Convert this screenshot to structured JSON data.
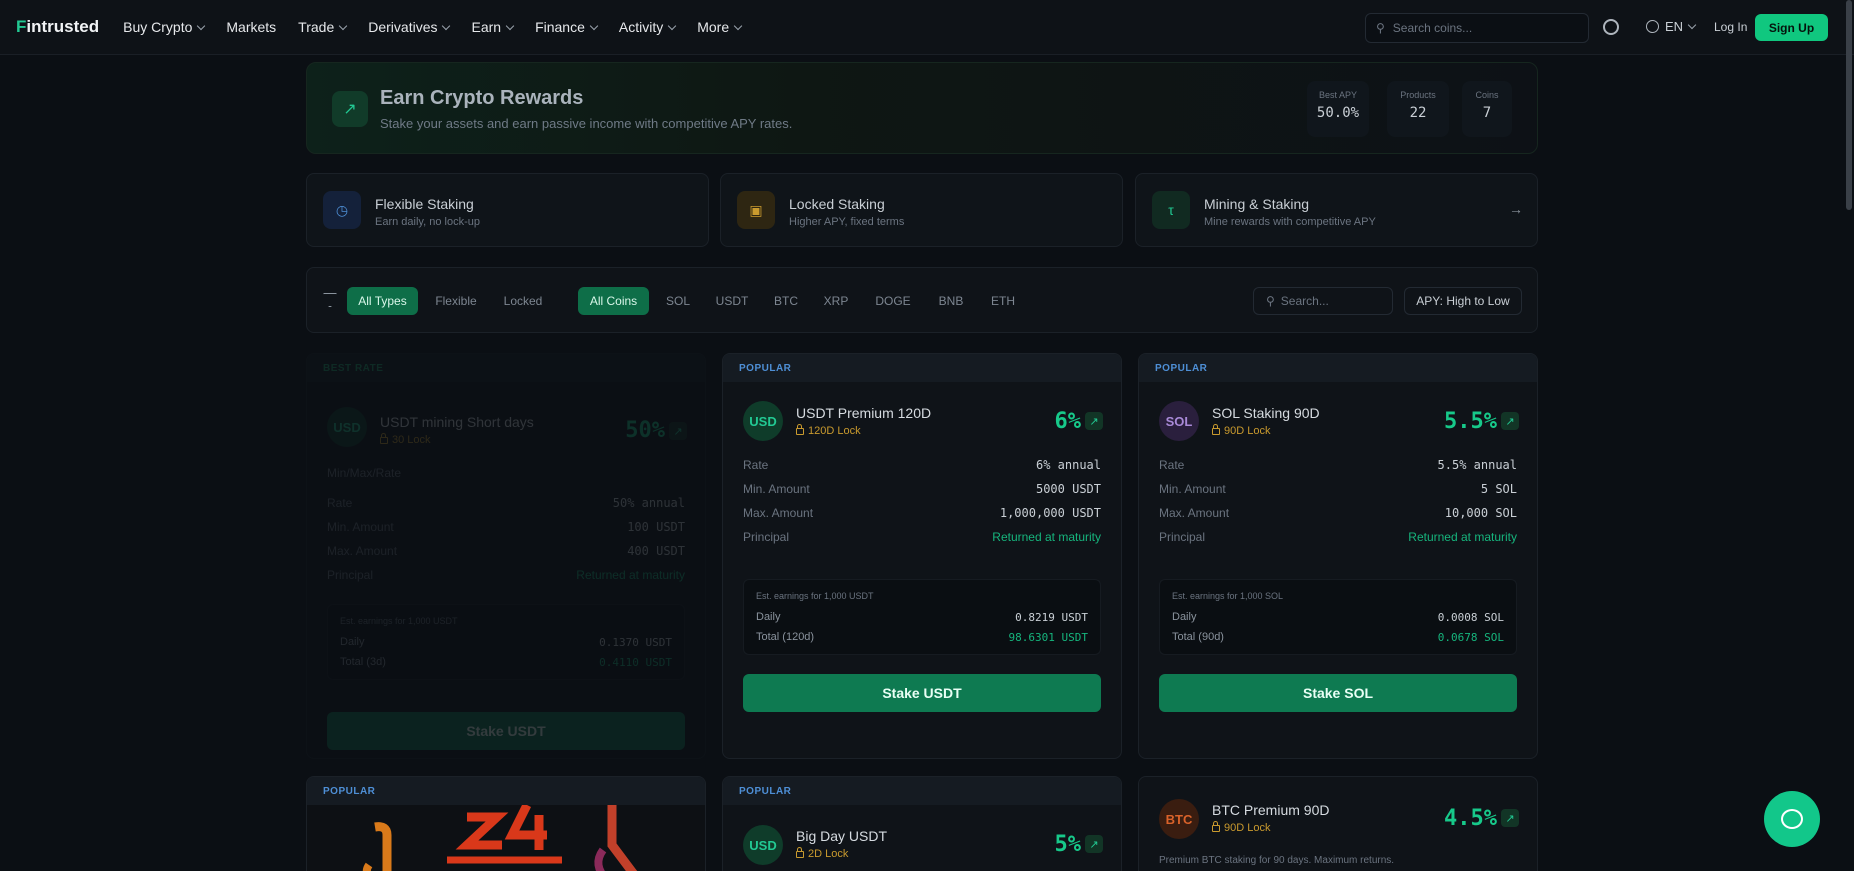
{
  "nav": {
    "logo": "Fintrusted",
    "logo_first": "F",
    "logo_rest": "intrusted",
    "items": [
      {
        "label": "Buy Crypto",
        "dropdown": true
      },
      {
        "label": "Markets",
        "dropdown": false
      },
      {
        "label": "Trade",
        "dropdown": true
      },
      {
        "label": "Derivatives",
        "dropdown": true
      },
      {
        "label": "Earn",
        "dropdown": true
      },
      {
        "label": "Finance",
        "dropdown": true
      },
      {
        "label": "Activity",
        "dropdown": true
      },
      {
        "label": "More",
        "dropdown": true
      }
    ],
    "search_placeholder": "Search coins...",
    "language": "EN",
    "login": "Log In",
    "signup": "Sign Up"
  },
  "hero": {
    "title": "Earn Crypto Rewards",
    "subtitle": "Stake your assets and earn passive income with competitive APY rates.",
    "stats": [
      {
        "label": "Best APY",
        "value": "50.0%"
      },
      {
        "label": "Products",
        "value": "22"
      },
      {
        "label": "Coins",
        "value": "7"
      }
    ]
  },
  "staking_types": [
    {
      "title": "Flexible Staking",
      "subtitle": "Earn daily, no lock-up",
      "icon": "clock-icon"
    },
    {
      "title": "Locked Staking",
      "subtitle": "Higher APY, fixed terms",
      "icon": "lock-icon"
    },
    {
      "title": "Mining & Staking",
      "subtitle": "Mine rewards with competitive APY",
      "icon": "pickaxe-icon"
    }
  ],
  "filters": {
    "types": [
      "All Types",
      "Flexible",
      "Locked"
    ],
    "coins": [
      "All Coins",
      "SOL",
      "USDT",
      "BTC",
      "XRP",
      "DOGE",
      "BNB",
      "ETH"
    ],
    "search_placeholder": "Search...",
    "sort": "APY: High to Low"
  },
  "products": [
    {
      "badge": "BEST RATE",
      "coin": "USD",
      "name": "USDT mining Short days",
      "lock": "30 Lock",
      "apy": "50%",
      "section": "Min/Max/Rate",
      "rows": [
        {
          "k": "Rate",
          "v": "50% annual"
        },
        {
          "k": "Min. Amount",
          "v": "100 USDT"
        },
        {
          "k": "Max. Amount",
          "v": "400 USDT"
        },
        {
          "k": "Principal",
          "v": "Returned at maturity"
        }
      ],
      "est_title": "Est. earnings for 1,000 USDT",
      "est_daily_label": "Daily",
      "est_daily": "0.1370 USDT",
      "est_total_label": "Total (3d)",
      "est_total": "0.4110 USDT",
      "button": "Stake USDT"
    },
    {
      "badge": "POPULAR",
      "coin": "USD",
      "name": "USDT Premium 120D",
      "lock": "120D Lock",
      "apy": "6%",
      "rows": [
        {
          "k": "Rate",
          "v": "6% annual"
        },
        {
          "k": "Min. Amount",
          "v": "5000 USDT"
        },
        {
          "k": "Max. Amount",
          "v": "1,000,000 USDT"
        },
        {
          "k": "Principal",
          "v": "Returned at maturity"
        }
      ],
      "est_title": "Est. earnings for 1,000 USDT",
      "est_daily_label": "Daily",
      "est_daily": "0.8219 USDT",
      "est_total_label": "Total (120d)",
      "est_total": "98.6301 USDT",
      "button": "Stake USDT"
    },
    {
      "badge": "POPULAR",
      "coin": "SOL",
      "name": "SOL Staking 90D",
      "lock": "90D Lock",
      "apy": "5.5%",
      "rows": [
        {
          "k": "Rate",
          "v": "5.5% annual"
        },
        {
          "k": "Min. Amount",
          "v": "5 SOL"
        },
        {
          "k": "Max. Amount",
          "v": "10,000 SOL"
        },
        {
          "k": "Principal",
          "v": "Returned at maturity"
        }
      ],
      "est_title": "Est. earnings for 1,000 SOL",
      "est_daily_label": "Daily",
      "est_daily": "0.0008 SOL",
      "est_total_label": "Total (90d)",
      "est_total": "0.0678 SOL",
      "button": "Stake SOL"
    },
    {
      "badge": "POPULAR"
    },
    {
      "badge": "POPULAR",
      "coin": "USD",
      "name": "Big Day USDT",
      "lock": "2D Lock",
      "apy": "5%"
    },
    {
      "coin": "BTC",
      "name": "BTC Premium 90D",
      "lock": "90D Lock",
      "apy": "4.5%",
      "description": "Premium BTC staking for 90 days. Maximum returns."
    }
  ],
  "colors": {
    "accent": "#10c77f",
    "apy_green": "#17c98a",
    "popular_blue": "#4e8fd6",
    "lock_gold": "#c99a2e"
  }
}
